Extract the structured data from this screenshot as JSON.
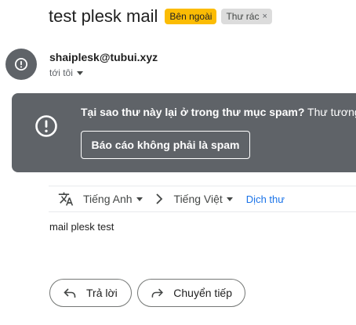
{
  "message": {
    "subject": "test plesk mail",
    "labels": {
      "external": "Bên ngoài",
      "spam": "Thư rác",
      "spam_remove": "×"
    },
    "sender_email": "shaiplesk@tubui.xyz",
    "recipient": "tới tôi",
    "body": "mail plesk test"
  },
  "spam_banner": {
    "question": "Tại sao thư này lại ở trong thư mục spam?",
    "explanation": "Thư tương",
    "report_button": "Báo cáo không phải là spam"
  },
  "translate": {
    "from_lang": "Tiếng Anh",
    "to_lang": "Tiếng Việt",
    "link": "Dịch thư"
  },
  "actions": {
    "reply": "Trả lời",
    "forward": "Chuyển tiếp"
  },
  "colors": {
    "external_badge": "#fbbc04",
    "spam_badge": "#dcdcdc",
    "banner_bg": "#5f6368",
    "link": "#1a73e8"
  },
  "icons": {
    "avatar": "exclamation-circle-icon",
    "warning": "exclamation-circle-icon",
    "translate": "translate-icon",
    "reply": "reply-arrow-icon",
    "forward": "forward-arrow-icon"
  }
}
